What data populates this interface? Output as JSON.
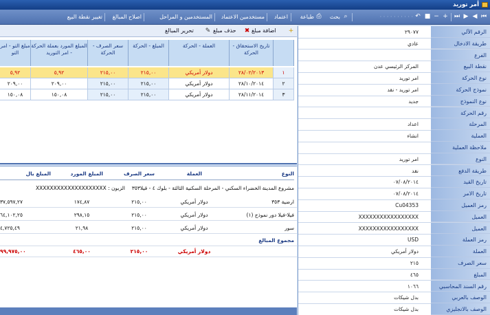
{
  "window": {
    "title": "أمر توريد"
  },
  "toolbar": {
    "items": [
      {
        "label": "تغيير نقطة البيع",
        "dis": false
      },
      {
        "label": "اصلاح المبالغ",
        "dis": false
      },
      {
        "label": "المستخدمين و المراحل",
        "dis": false
      },
      {
        "label": "مستخدمين الاعتماد",
        "dis": false
      },
      {
        "label": "اعتماد",
        "dis": false
      },
      {
        "label": "طباعة",
        "dis": false
      },
      {
        "label": "بحث",
        "dis": false
      }
    ]
  },
  "subtoolbar": {
    "add": "اضافة مبلغ",
    "delete": "حذف مبلغ",
    "edit": "تحرير المبالغ"
  },
  "grid": {
    "headers": [
      "تاريخ الاستحقاق - الحركة",
      "العملة - الحركة",
      "المبلغ - الحركة",
      "سعر الصرف - الحركة",
      "المبلغ المورد بعملة الحركة - امر التوريد",
      "مبلغ التو - امر التو"
    ],
    "rows": [
      {
        "n": "١",
        "date": "٢٨/٠٢/٢٠١٣",
        "cur": "دولار أمريكي",
        "amt": "٢١٥,٠٠",
        "rate": "٢١٥,٠٠",
        "sup": "٥,٩٢",
        "last": "٥,٩٢"
      },
      {
        "n": "٢",
        "date": "٢٨/١٠/٢٠١٤",
        "cur": "دولار أمريكي",
        "amt": "٢١٥,٠٠",
        "rate": "٢١٥,٠٠",
        "sup": "٢٠٩,٠٠",
        "last": "٢٠٩,٠٠"
      },
      {
        "n": "٣",
        "date": "٢٨/١١/٢٠١٤",
        "cur": "دولار أمريكي",
        "amt": "٢١٥,٠٠",
        "rate": "٢١٥,٠٠",
        "sup": "١٥٠,٠٨",
        "last": "١٥٠,٠٨"
      }
    ]
  },
  "report": {
    "headers": {
      "type": "النوع",
      "cur": "العملة",
      "rate": "سعر الصرف",
      "sup": "المبلغ المورد",
      "amt": "المبلغ بال"
    },
    "project": "مشروع المدينة الخضراء السكني - المرحلة السكنية الثالثة - بلوك ٤ - قيلا٣٥٣",
    "customer": "الزبون : XXXXXXXXXXXXXXXXXXXX",
    "rows": [
      {
        "type": "ارضية ٣٥٣",
        "cur": "دولار أمريكي",
        "rate": "٢١٥,٠٠",
        "sup": "١٧٤,٨٧",
        "amt": "٣٧,٥٩٧,٢٧"
      },
      {
        "type": "فيلا-فيلا دور نموذج (١)",
        "cur": "دولار أمريكي",
        "rate": "٢١٥,٠٠",
        "sup": "٢٩٨,١٥",
        "amt": "٦٤,١٠٢,٢٥"
      },
      {
        "type": "سور",
        "cur": "دولار أمريكي",
        "rate": "٢١٥,٠٠",
        "sup": "٢١,٩٨",
        "amt": "٤,٧٢٥,٤٩"
      }
    ],
    "total_label": "مجموع المبالغ",
    "total": {
      "cur": "دولار أمريكي",
      "rate": "٢١٥,٠٠",
      "sup": "٤٦٥,٠٠",
      "amt": "٩٩,٩٧٥,٠٠"
    }
  },
  "props": [
    {
      "label": "الرقم الآلي",
      "value": "٢٩٠٧٧"
    },
    {
      "label": "طريقة الادخال",
      "value": "عادي"
    },
    {
      "label": "الفرع",
      "value": ""
    },
    {
      "label": "نقطة البيع",
      "value": "المركز الرئيسي عدن"
    },
    {
      "label": "نوع الحركة",
      "value": "امر توريد"
    },
    {
      "label": "نموذج الحركة",
      "value": "امر توريد - نقد"
    },
    {
      "label": "نوع النموذج",
      "value": "جديد"
    },
    {
      "label": "رقم الحركة",
      "value": ""
    },
    {
      "label": "المرحلة",
      "value": "اعداد"
    },
    {
      "label": "العملية",
      "value": "انشاء"
    },
    {
      "label": "ملاحظة العملية",
      "value": ""
    },
    {
      "label": "النوع",
      "value": "امر توريد"
    },
    {
      "label": "طريقة الدفع",
      "value": "نقد"
    },
    {
      "label": "تاريخ القيد",
      "value": "٠٧/٠٨/٢٠١٤"
    },
    {
      "label": "تاريخ الامر",
      "value": "٠٧/٠٨/٢٠١٤"
    },
    {
      "label": "رمز العميل",
      "value": "Cu04353"
    },
    {
      "label": "العميل",
      "value": "XXXXXXXXXXXXXXXXX"
    },
    {
      "label": "العميل",
      "value": "XXXXXXXXXXXXXXXXX"
    },
    {
      "label": "رمز العملة",
      "value": "USD"
    },
    {
      "label": "العملة",
      "value": "دولار أمريكي"
    },
    {
      "label": "سعر الصرف",
      "value": "٢١٥"
    },
    {
      "label": "المبلغ",
      "value": "٤٦٥"
    },
    {
      "label": "رقم السند المحاسبي",
      "value": "١٠٦٦"
    },
    {
      "label": "الوصف بالعربي",
      "value": "بدل شيكات"
    },
    {
      "label": "الوصف بالانجليزي",
      "value": "بدل شيكات"
    }
  ]
}
